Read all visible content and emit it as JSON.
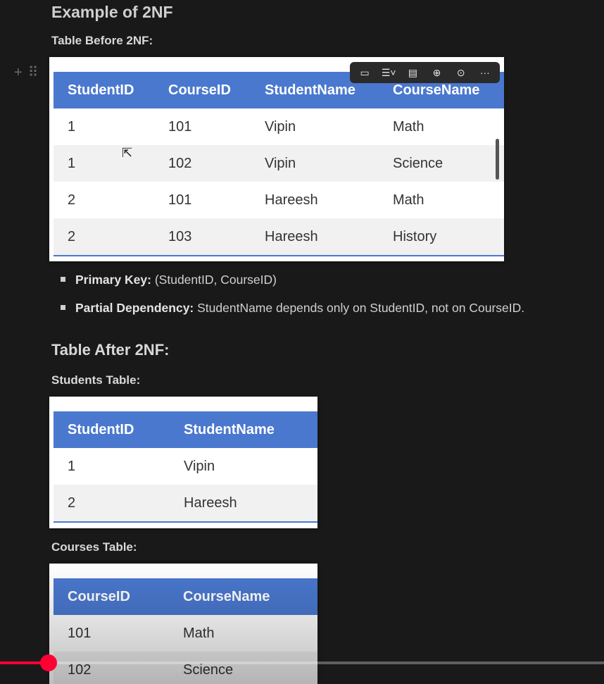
{
  "title": "Example of 2NF",
  "before_label": "Table Before 2NF:",
  "table_before": {
    "headers": [
      "StudentID",
      "CourseID",
      "StudentName",
      "CourseName"
    ],
    "rows": [
      [
        "1",
        "101",
        "Vipin",
        "Math"
      ],
      [
        "1",
        "102",
        "Vipin",
        "Science"
      ],
      [
        "2",
        "101",
        "Hareesh",
        "Math"
      ],
      [
        "2",
        "103",
        "Hareesh",
        "History"
      ]
    ]
  },
  "bullets": [
    {
      "bold": "Primary Key:",
      "text": " (StudentID, CourseID)"
    },
    {
      "bold": "Partial Dependency:",
      "text": " StudentName depends only on StudentID, not on CourseID."
    }
  ],
  "after_heading": "Table After 2NF:",
  "students_label": "Students Table:",
  "students_table": {
    "headers": [
      "StudentID",
      "StudentName"
    ],
    "rows": [
      [
        "1",
        "Vipin"
      ],
      [
        "2",
        "Hareesh"
      ]
    ]
  },
  "courses_label": "Courses Table:",
  "courses_table": {
    "headers": [
      "CourseID",
      "CourseName"
    ],
    "rows": [
      [
        "101",
        "Math"
      ],
      [
        "102",
        "Science"
      ]
    ]
  },
  "toolbar_icons": [
    "comment-icon",
    "align-icon",
    "caption-icon",
    "zoom-in-icon",
    "download-icon",
    "more-icon"
  ],
  "video_progress": 0.08,
  "accent": "#4a78cf",
  "progress_color": "#ff0033"
}
